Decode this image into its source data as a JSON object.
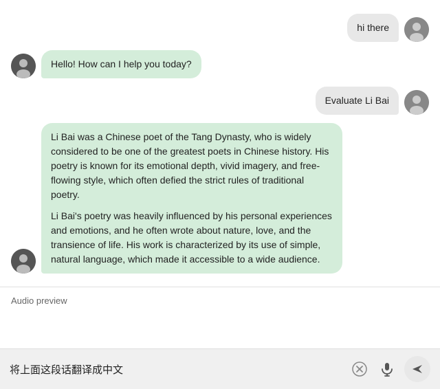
{
  "messages": [
    {
      "id": "msg1",
      "role": "user",
      "text": "hi there"
    },
    {
      "id": "msg2",
      "role": "bot",
      "paragraphs": [
        "Hello! How can I help you today?"
      ]
    },
    {
      "id": "msg3",
      "role": "user",
      "text": "Evaluate Li Bai"
    },
    {
      "id": "msg4",
      "role": "bot",
      "paragraphs": [
        "Li Bai was a Chinese poet of the Tang Dynasty, who is widely considered to be one of the greatest poets in Chinese history. His poetry is known for its emotional depth, vivid imagery, and free-flowing style, which often defied the strict rules of traditional poetry.",
        "Li Bai's poetry was heavily influenced by his personal experiences and emotions, and he often wrote about nature, love, and the transience of life. His work is characterized by its use of simple, natural language, which made it accessible to a wide audience."
      ]
    }
  ],
  "audio_preview": {
    "label": "Audio preview"
  },
  "input": {
    "placeholder": "",
    "value": "将上面这段话翻译成中文"
  },
  "icons": {
    "clear": "✕",
    "mic": "🎤",
    "send": "➤"
  }
}
